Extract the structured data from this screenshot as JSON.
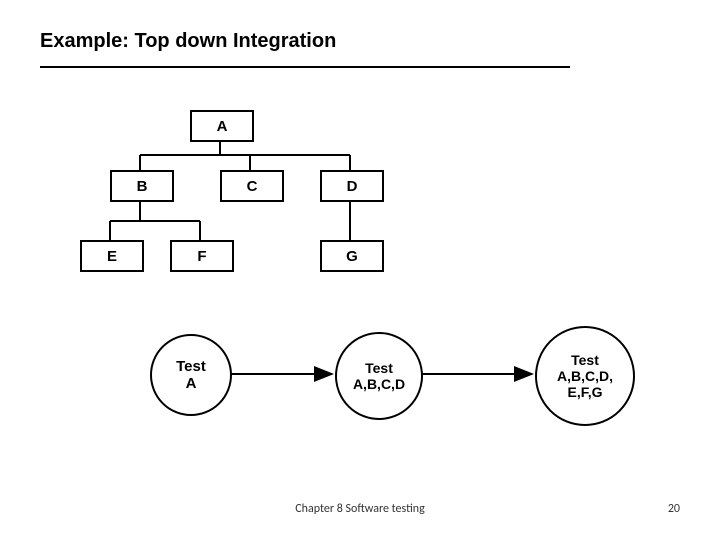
{
  "title": "Example: Top down Integration",
  "tree": {
    "a": "A",
    "b": "B",
    "c": "C",
    "d": "D",
    "e": "E",
    "f": "F",
    "g": "G"
  },
  "flow": {
    "step1": {
      "line1": "Test",
      "line2": "A"
    },
    "step2": {
      "line1": "Test",
      "line2": "A,B,C,D"
    },
    "step3": {
      "line1": "Test",
      "line2": "A,B,C,D,",
      "line3": "E,F,G"
    }
  },
  "footer": {
    "center": "Chapter 8 Software testing",
    "page": "20"
  }
}
